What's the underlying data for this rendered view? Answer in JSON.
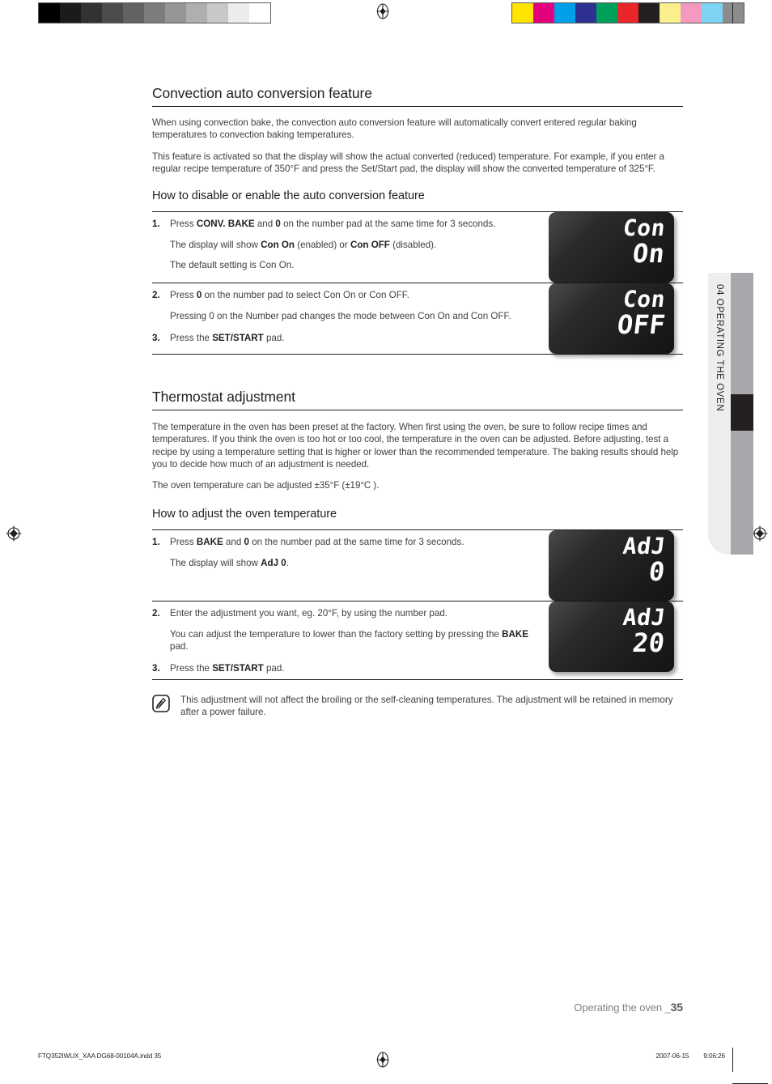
{
  "document": {
    "section_tab": "04  OPERATING THE OVEN",
    "page_footer_text": "Operating the oven _",
    "page_number": "35",
    "print_file": "FTQ352IWUX_XAA DG68-00104A.indd   35",
    "print_page": "",
    "print_date": "2007-06-15",
    "print_time": "9:06:26"
  },
  "calibration": {
    "grayscale": [
      "#000000",
      "#1c1a1a",
      "#333133",
      "#4d4b4c",
      "#636162",
      "#7d7b7c",
      "#969495",
      "#b0aeae",
      "#c9c7c7",
      "#ececec",
      "#ffffff"
    ],
    "colors": [
      "#ffe400",
      "#e5007e",
      "#00a0e9",
      "#2e3192",
      "#00a05a",
      "#e8262a",
      "#231f20",
      "#fbef8b",
      "#f49ac1",
      "#7fd4f4",
      "#8c8c8c"
    ]
  },
  "sections": [
    {
      "id": "convection-auto-conversion",
      "heading": "Convection auto conversion feature",
      "paragraphs": [
        "When using convection bake, the convection auto conversion feature will automatically convert entered regular baking temperatures to convection baking temperatures.",
        "This feature is activated so that the display will show the actual converted (reduced) temperature. For example, if you enter a regular recipe temperature of 350°F and press the Set/Start pad, the display will show the converted temperature of 325°F."
      ],
      "subheading": "How to disable or enable the auto conversion feature",
      "steps": [
        {
          "number": "1.",
          "lines": [
            {
              "type": "main",
              "text": "Press CONV. BAKE and 0 on the number pad at the same time for 3 seconds.",
              "bold": [
                "CONV. BAKE",
                "0"
              ]
            },
            {
              "type": "sub",
              "text": "The display will show Con On (enabled) or Con OFF (disabled).",
              "bold": [
                "Con On",
                "Con OFF"
              ]
            },
            {
              "type": "sub",
              "text": "The default setting is Con On.",
              "bold": []
            }
          ],
          "display": {
            "line1": "Con",
            "line2": "On"
          }
        },
        {
          "number": "2.",
          "lines": [
            {
              "type": "main",
              "text": "Press 0 on the number pad to select Con On or Con OFF.",
              "bold": [
                "0"
              ]
            },
            {
              "type": "sub",
              "text": "Pressing 0 on the Number pad changes the mode between Con On and Con OFF.",
              "bold": []
            }
          ],
          "display": {
            "line1": "Con",
            "line2": "OFF"
          }
        },
        {
          "number": "3.",
          "lines": [
            {
              "type": "main",
              "text": "Press the SET/START pad.",
              "bold": [
                "SET/START"
              ]
            }
          ],
          "display": null
        }
      ]
    },
    {
      "id": "thermostat-adjustment",
      "heading": "Thermostat adjustment",
      "paragraphs": [
        "The temperature in the oven has been preset at the factory. When first using the oven, be sure to follow recipe times and temperatures. If you think the oven is too hot or too cool, the temperature in the oven can be adjusted. Before adjusting, test a recipe by using a temperature setting that is higher or lower than the recommended temperature. The baking results should help you to decide how much of an adjustment is needed.",
        "The oven temperature can be adjusted ±35°F (±19°C )."
      ],
      "subheading": "How to adjust the oven temperature",
      "steps": [
        {
          "number": "1.",
          "lines": [
            {
              "type": "main",
              "text": "Press BAKE and 0 on the number pad at the same time for 3 seconds.",
              "bold": [
                "BAKE",
                "0"
              ]
            },
            {
              "type": "sub",
              "text": "The display will show AdJ 0.",
              "bold": [
                "AdJ 0"
              ]
            }
          ],
          "display": {
            "line1": "AdJ",
            "line2": "0"
          }
        },
        {
          "number": "2.",
          "lines": [
            {
              "type": "main",
              "text": "Enter the adjustment you want, eg. 20°F, by using the number pad.",
              "bold": []
            },
            {
              "type": "sub",
              "text": "You can adjust the temperature to lower than the factory setting by pressing the BAKE pad.",
              "bold": [
                "BAKE"
              ]
            }
          ],
          "display": {
            "line1": "AdJ",
            "line2": "20"
          }
        },
        {
          "number": "3.",
          "lines": [
            {
              "type": "main",
              "text": "Press the SET/START pad.",
              "bold": [
                "SET/START"
              ]
            }
          ],
          "display": null
        }
      ]
    }
  ],
  "note": {
    "icon": "note-pen-icon",
    "text": "This adjustment will not affect the broiling or the self-cleaning temperatures. The adjustment will be retained in memory after a power failure."
  }
}
